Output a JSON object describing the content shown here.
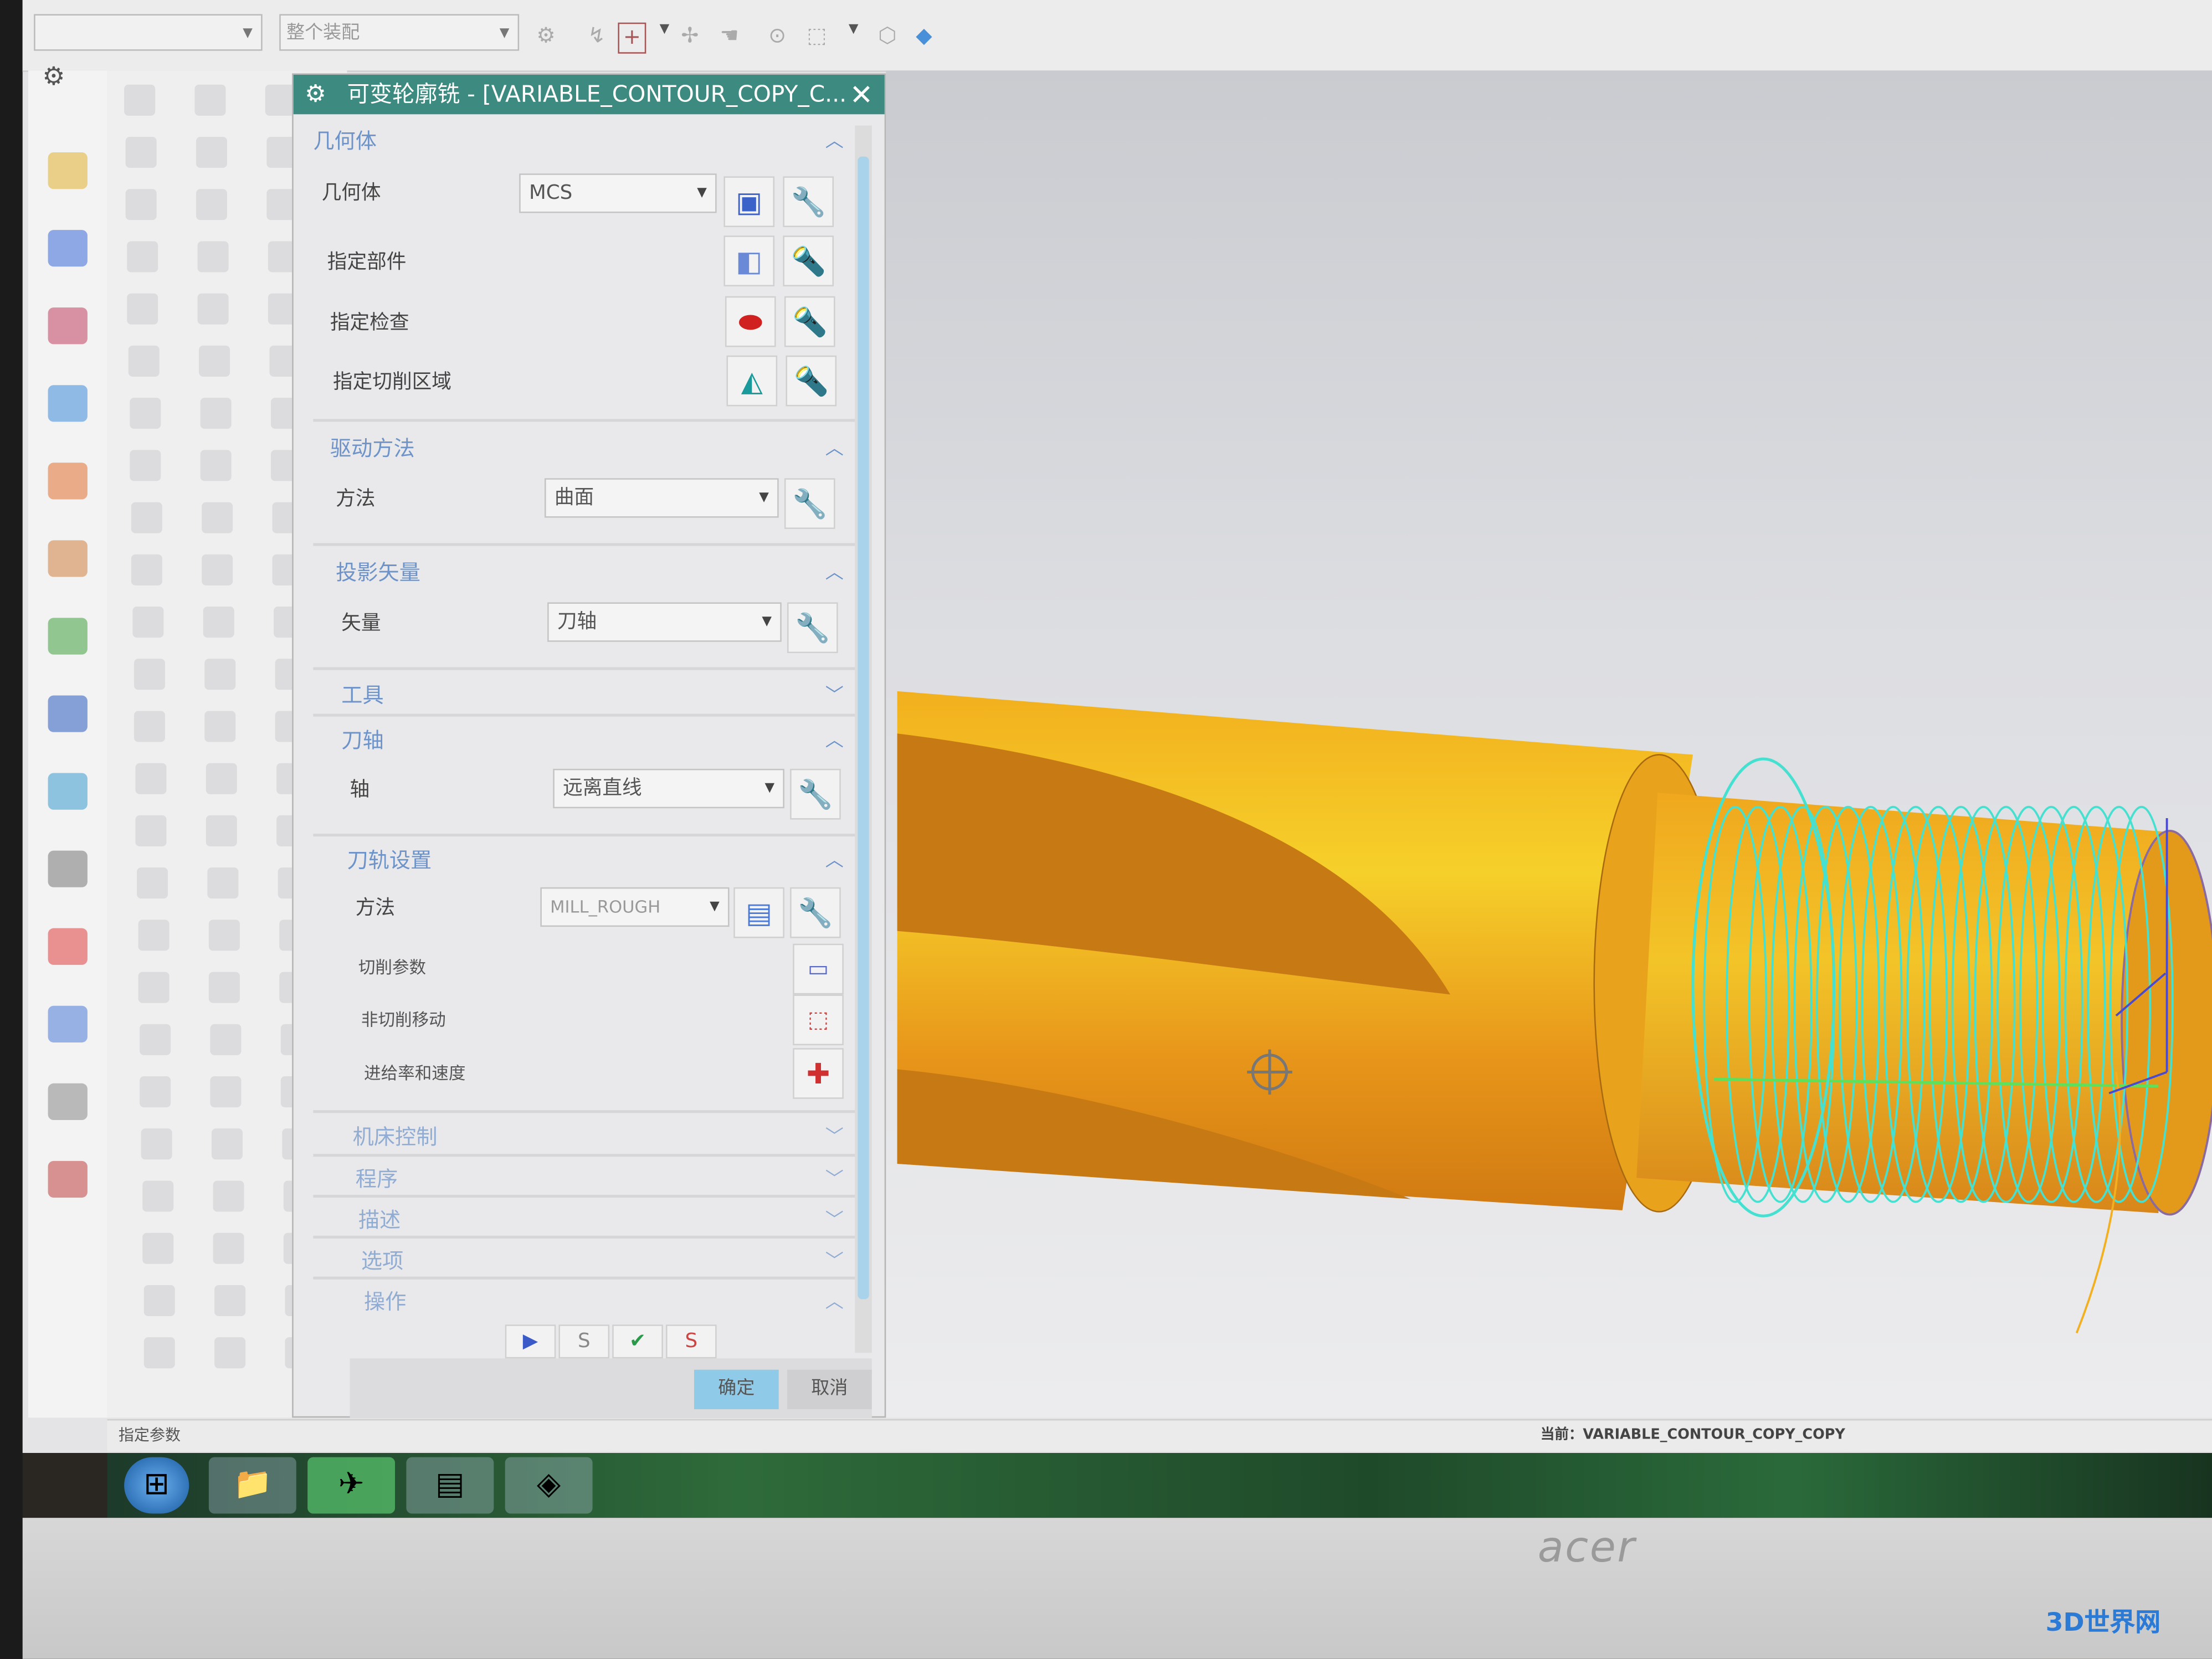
{
  "toolbar": {
    "filter_value": "",
    "assembly_scope": "整个装配"
  },
  "dialog": {
    "title": "可变轮廓铣 - [VARIABLE_CONTOUR_COPY_C...",
    "sections": {
      "geometry": {
        "header": "几何体",
        "geometry_label": "几何体",
        "geometry_value": "MCS",
        "part_label": "指定部件",
        "check_label": "指定检查",
        "cut_area_label": "指定切削区域"
      },
      "drive": {
        "header": "驱动方法",
        "method_label": "方法",
        "method_value": "曲面"
      },
      "projection": {
        "header": "投影矢量",
        "vector_label": "矢量",
        "vector_value": "刀轴"
      },
      "tool": {
        "header": "工具"
      },
      "tool_axis": {
        "header": "刀轴",
        "axis_label": "轴",
        "axis_value": "远离直线"
      },
      "path_settings": {
        "header": "刀轨设置",
        "method_label": "方法",
        "method_value": "MILL_ROUGH",
        "cut_params": "切削参数",
        "non_cut_moves": "非切削移动",
        "feeds_speeds": "进给率和速度"
      },
      "machine_control": {
        "header": "机床控制"
      },
      "program": {
        "header": "程序"
      },
      "description": {
        "header": "描述"
      },
      "options": {
        "header": "选项"
      },
      "actions": {
        "header": "操作"
      }
    },
    "ok": "确定",
    "cancel": "取消"
  },
  "statusbar": {
    "prompt": "指定参数",
    "current": "当前：VARIABLE_CONTOUR_COPY_COPY"
  },
  "monitor": {
    "brand": "acer"
  },
  "watermark": "3D世界网",
  "colors": {
    "title_bar": "#3d8a80",
    "section_header": "#6d93c9",
    "ok_button": "#8fcbe8",
    "part": "#f0a81e",
    "thread": "#45e0d0"
  }
}
